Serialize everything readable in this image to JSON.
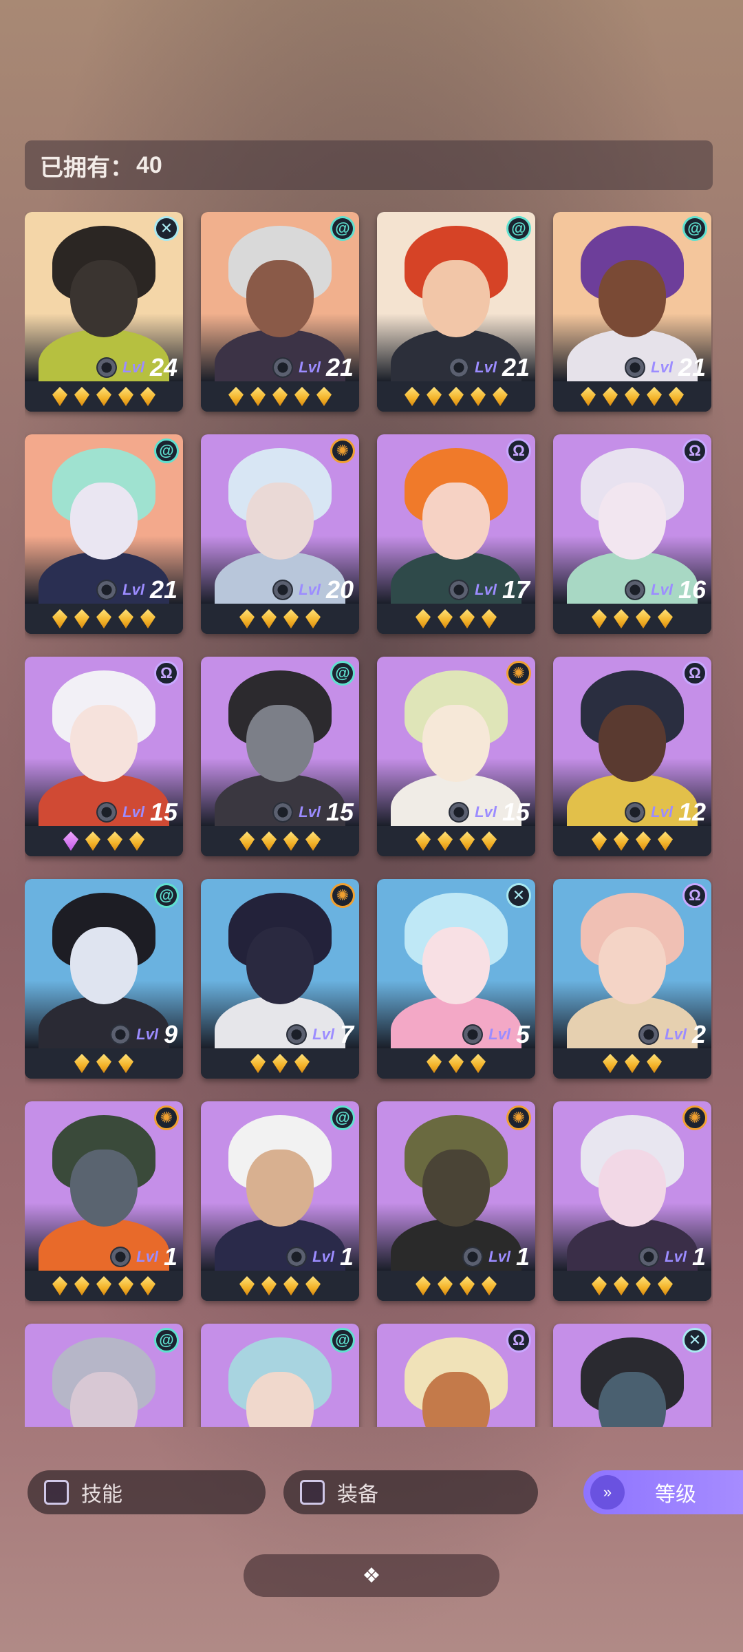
{
  "header": {
    "owned_label": "已拥有：",
    "owned_count": "40"
  },
  "heroes": [
    {
      "level": "24",
      "stars": 5,
      "purple": 0,
      "element": "void",
      "palette": [
        "#f4d6a8",
        "#2b2623",
        "#3a3430",
        "#b6c040"
      ]
    },
    {
      "level": "21",
      "stars": 5,
      "purple": 0,
      "element": "wind",
      "palette": [
        "#f1b08d",
        "#d9d9d9",
        "#8a5a48",
        "#3c3346"
      ]
    },
    {
      "level": "21",
      "stars": 5,
      "purple": 0,
      "element": "wind",
      "palette": [
        "#f4e3d0",
        "#d64326",
        "#f2c6a8",
        "#2c2f3a"
      ]
    },
    {
      "level": "21",
      "stars": 5,
      "purple": 0,
      "element": "wind",
      "palette": [
        "#f4c69c",
        "#6d3e9a",
        "#7a4a35",
        "#e6e2ea"
      ]
    },
    {
      "level": "21",
      "stars": 5,
      "purple": 0,
      "element": "wind",
      "palette": [
        "#f3a98c",
        "#9fe2d0",
        "#eae6f2",
        "#2a2f52"
      ]
    },
    {
      "level": "20",
      "stars": 4,
      "purple": 0,
      "element": "sun",
      "palette": [
        "#c58fe8",
        "#d8e6f4",
        "#ead9d6",
        "#b8c6da"
      ]
    },
    {
      "level": "17",
      "stars": 4,
      "purple": 0,
      "element": "omega",
      "palette": [
        "#c58fe8",
        "#f07a2a",
        "#f6d2c4",
        "#2f4a4a"
      ]
    },
    {
      "level": "16",
      "stars": 4,
      "purple": 0,
      "element": "omega",
      "palette": [
        "#c58fe8",
        "#e8e2f0",
        "#f2e6f0",
        "#a8d8c4"
      ]
    },
    {
      "level": "15",
      "stars": 3,
      "purple": 1,
      "element": "omega",
      "palette": [
        "#c58fe8",
        "#f2f0f6",
        "#f6e2dc",
        "#d04a34"
      ]
    },
    {
      "level": "15",
      "stars": 4,
      "purple": 0,
      "element": "wind",
      "palette": [
        "#c58fe8",
        "#2c2a2e",
        "#7c7f88",
        "#3a3740"
      ]
    },
    {
      "level": "15",
      "stars": 4,
      "purple": 0,
      "element": "sun",
      "palette": [
        "#c58fe8",
        "#dfe5b8",
        "#f6e8d8",
        "#f0ece6"
      ]
    },
    {
      "level": "12",
      "stars": 4,
      "purple": 0,
      "element": "omega",
      "palette": [
        "#c58fe8",
        "#2a2e40",
        "#5a3a30",
        "#e2c04a"
      ]
    },
    {
      "level": "9",
      "stars": 3,
      "purple": 0,
      "element": "wind",
      "palette": [
        "#6ab2e0",
        "#1d1d24",
        "#dfe4f0",
        "#2a2a34"
      ]
    },
    {
      "level": "7",
      "stars": 3,
      "purple": 0,
      "element": "sun",
      "palette": [
        "#6ab2e0",
        "#23223a",
        "#2a2940",
        "#e6e6ea"
      ]
    },
    {
      "level": "5",
      "stars": 3,
      "purple": 0,
      "element": "void",
      "palette": [
        "#6ab2e0",
        "#bfe8f6",
        "#f8e0e4",
        "#f3a8c6"
      ]
    },
    {
      "level": "2",
      "stars": 3,
      "purple": 0,
      "element": "omega",
      "palette": [
        "#6ab2e0",
        "#f0c0b4",
        "#f4d4c6",
        "#e6d0b0"
      ]
    },
    {
      "level": "1",
      "stars": 5,
      "purple": 0,
      "element": "sun",
      "palette": [
        "#c58fe8",
        "#3a4a3a",
        "#5a6470",
        "#e86a2a"
      ]
    },
    {
      "level": "1",
      "stars": 4,
      "purple": 0,
      "element": "wind",
      "palette": [
        "#c58fe8",
        "#f2f2f2",
        "#d8b090",
        "#2a2a4a"
      ]
    },
    {
      "level": "1",
      "stars": 4,
      "purple": 0,
      "element": "sun",
      "palette": [
        "#c58fe8",
        "#6a6a40",
        "#4a4436",
        "#2a2a2a"
      ]
    },
    {
      "level": "1",
      "stars": 4,
      "purple": 0,
      "element": "sun",
      "palette": [
        "#c58fe8",
        "#e8e6f0",
        "#f2d8e6",
        "#3a2e48"
      ]
    },
    {
      "level": "",
      "stars": 0,
      "purple": 0,
      "element": "wind",
      "palette": [
        "#c58fe8",
        "#b6b6c8",
        "#d8c8d4",
        "#3a3a4a"
      ]
    },
    {
      "level": "",
      "stars": 0,
      "purple": 0,
      "element": "wind",
      "palette": [
        "#c58fe8",
        "#a8d4e0",
        "#f0d8cc",
        "#3a3a4a"
      ]
    },
    {
      "level": "",
      "stars": 0,
      "purple": 0,
      "element": "omega",
      "palette": [
        "#c58fe8",
        "#f0e2b8",
        "#c47a4a",
        "#2a4a8a"
      ]
    },
    {
      "level": "",
      "stars": 0,
      "purple": 0,
      "element": "void",
      "palette": [
        "#c58fe8",
        "#2a2a30",
        "#4a6070",
        "#c23030"
      ]
    }
  ],
  "element_icons": {
    "wind": "@",
    "sun": "✺",
    "omega": "Ω",
    "void": "✕"
  },
  "element_colors": {
    "wind": "#5fe0cf",
    "sun": "#f0a030",
    "omega": "#c8a8ff",
    "void": "#a8e8f0"
  },
  "level_prefix": "Lvl",
  "filters": {
    "skill_label": "技能",
    "equipment_label": "装备",
    "sort_label": "等级",
    "sort_icon": "»"
  },
  "expand_icon": "❖"
}
